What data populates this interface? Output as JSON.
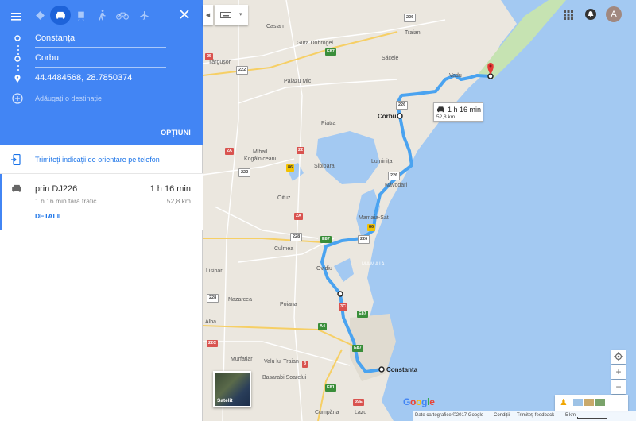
{
  "panel": {
    "origin": "Constanța",
    "waypoint": "Corbu",
    "destination": "44.4484568, 28.7850374",
    "add_destination_placeholder": "Adăugați o destinație",
    "options_label": "OPȚIUNI",
    "send_to_phone": "Trimiteți indicații de orientare pe telefon"
  },
  "route": {
    "via": "prin DJ226",
    "duration": "1 h 16 min",
    "no_traffic": "1 h 16 min fără trafic",
    "distance": "52,8 km",
    "details": "DETALII"
  },
  "bubble": {
    "duration": "1 h 16 min",
    "distance": "52,8 km"
  },
  "map": {
    "labels": {
      "casian": "Casian",
      "gura": "Gura Dobrogei",
      "traian": "Traian",
      "sacele": "Săcele",
      "targusor": "Târgușor",
      "palazu": "Palazu Mic",
      "vadu": "Vadu",
      "corbu": "Corbu",
      "piatra": "Piatra",
      "mihail": "Mihail",
      "kogalniceanu": "Kogălniceanu",
      "sibioara": "Sibioara",
      "luminita": "Luminița",
      "navodari": "Năvodari",
      "oituz": "Oituz",
      "mamaia_sat": "Mamaia-Sat",
      "mamaia": "MAMAIA",
      "ovidiu": "Ovidiu",
      "culmea": "Culmea",
      "lisipari": "Lisipari",
      "nazarcea": "Nazarcea",
      "poiana": "Poiana",
      "alba": "Alba",
      "murfatlar": "Murfatlar",
      "valu": "Valu lui Traian",
      "soarelui": "Basarabi Soarelui",
      "constanta": "Constanța",
      "cumpana": "Cumpăna",
      "lazu": "Lazu"
    },
    "shields": {
      "s226a": "226",
      "s226b": "226",
      "s226c": "226",
      "s226d": "226",
      "s222a": "222",
      "s222b": "222",
      "s22": "22",
      "s2a": "2A",
      "s2a2": "2A",
      "s22c": "22",
      "s86a": "86",
      "s86b": "86",
      "s226e": "226",
      "sE87a": "E87",
      "sE87b": "E87",
      "sE87c": "E87",
      "sE87d": "E87",
      "s3c": "3C",
      "sA4": "A4",
      "s3": "3",
      "s228": "228",
      "s228b": "228",
      "s22c2": "22C",
      "s39e": "39E",
      "sE81": "E81",
      "s25": "25"
    },
    "satellite_label": "Satelit"
  },
  "bottombar": {
    "data": "Date cartografice ©2017 Google",
    "terms": "Condiții",
    "feedback": "Trimiteți feedback",
    "scale": "5 km"
  },
  "logo": "Google",
  "avatar_letter": "A",
  "colors": {
    "panel_blue": "#4285f4",
    "route_blue": "#4aa3f0",
    "sea": "#a3c9f2",
    "land": "#ebe7df",
    "marker_red": "#e53935"
  }
}
